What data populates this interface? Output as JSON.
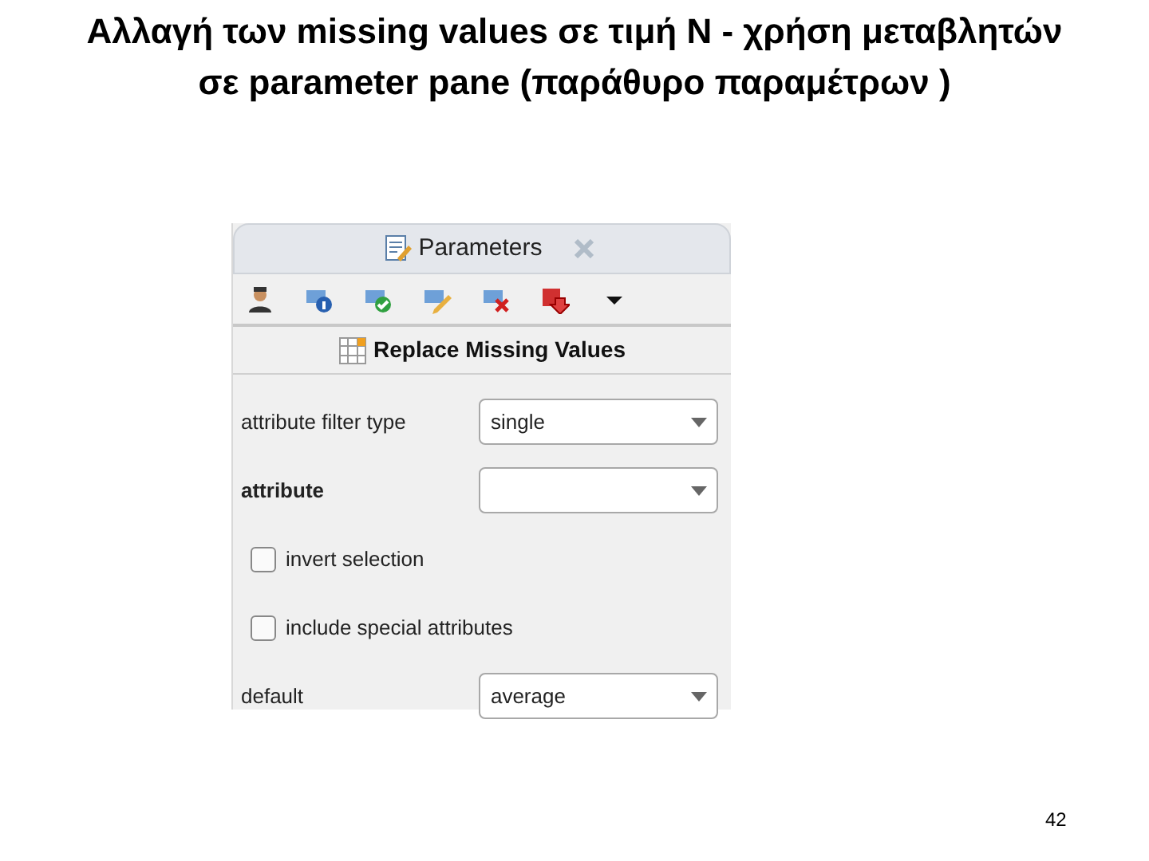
{
  "slide_title": "Αλλαγή των missing values σε τιμή Ν - χρήση μεταβλητών σε parameter pane (παράθυρο παραμέτρων )",
  "panel": {
    "tab": {
      "label": "Parameters",
      "selected": true
    },
    "toolbar": [
      {
        "kind": "user"
      },
      {
        "kind": "info"
      },
      {
        "kind": "check"
      },
      {
        "kind": "edit"
      },
      {
        "kind": "delete"
      },
      {
        "kind": "export"
      },
      {
        "kind": "more"
      }
    ],
    "operator": "Replace Missing Values",
    "parameters": [
      {
        "kind": "dropdown",
        "label": "attribute filter type",
        "required": false,
        "value": "single"
      },
      {
        "kind": "dropdown",
        "label": "attribute",
        "required": true
      },
      {
        "kind": "checkbox",
        "label": "invert selection",
        "checked": false
      },
      {
        "kind": "checkbox",
        "label": "include special attributes",
        "checked": false
      },
      {
        "kind": "dropdown",
        "label": "default",
        "required": false,
        "value": "average"
      }
    ]
  },
  "page_number": "42"
}
